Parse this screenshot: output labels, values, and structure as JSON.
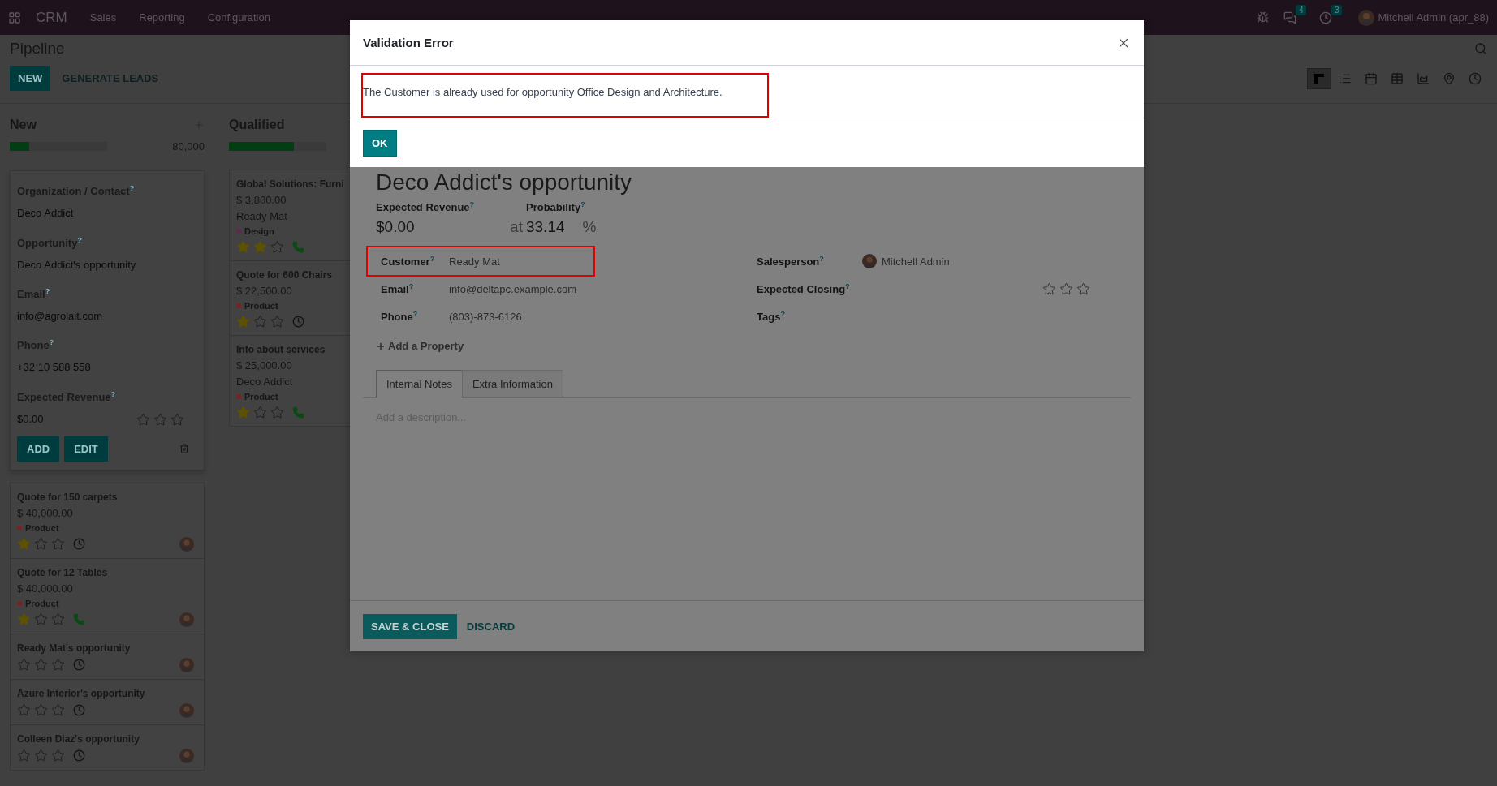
{
  "navbar": {
    "app": "CRM",
    "menus": [
      "Sales",
      "Reporting",
      "Configuration"
    ],
    "messages_badge": "4",
    "activities_badge": "3",
    "user": "Mitchell Admin (apr_88)"
  },
  "control_panel": {
    "breadcrumb": "Pipeline",
    "new_button": "NEW",
    "generate_button": "GENERATE LEADS",
    "views": [
      {
        "kind": "kanban",
        "selected": true
      },
      {
        "kind": "list",
        "selected": false
      },
      {
        "kind": "calendar",
        "selected": false
      },
      {
        "kind": "pivot",
        "selected": false
      },
      {
        "kind": "graph",
        "selected": false
      },
      {
        "kind": "map",
        "selected": false
      },
      {
        "kind": "activity",
        "selected": false
      }
    ]
  },
  "columns": [
    {
      "title": "New",
      "level": 0.2,
      "total": "80,000",
      "quick_create": {
        "fields": [
          {
            "label": "Organization / Contact$^{?}$",
            "value": "Deco Addict"
          },
          {
            "label": "Opportunity$^{?}$",
            "value": "Deco Addict's opportunity"
          },
          {
            "label": "Email$^{?}$",
            "value": "info@agrolait.com"
          },
          {
            "label": "Phone$^{?}$",
            "value": "+32 10 588 558"
          },
          {
            "label": "Expected Revenue$^{?}$",
            "value": "$0.00",
            "stars": 0
          }
        ],
        "buttons": [
          "ADD",
          "EDIT"
        ]
      },
      "cards": [
        {
          "title": "Quote for 150 carpets",
          "amount": "$ 40,000.00",
          "tag": {
            "label": "Product",
            "color": "#7a2222"
          },
          "stars": 1,
          "activity": {
            "kind": "clock"
          },
          "avatar": true
        },
        {
          "title": "Quote for 12 Tables",
          "amount": "$ 40,000.00",
          "tag": {
            "label": "Product",
            "color": "#7a2222"
          },
          "stars": 1,
          "activity": {
            "kind": "phone"
          },
          "avatar": true
        },
        {
          "title": "Ready Mat's opportunity",
          "stars": 0,
          "activity": {
            "kind": "clock"
          },
          "avatar": true
        },
        {
          "title": "Azure Interior's opportunity",
          "stars": 0,
          "activity": {
            "kind": "clock"
          },
          "avatar": true
        },
        {
          "title": "Colleen Diaz's opportunity",
          "stars": 0,
          "activity": {
            "kind": "clock"
          },
          "avatar": true
        }
      ]
    },
    {
      "title": "Qualified",
      "level": 0.67,
      "cards": [
        {
          "title": "Global Solutions: Furni",
          "amount": "$ 3,800.00",
          "customer": "Ready Mat",
          "tag": {
            "label": "Design",
            "color": "#5c2a4a"
          },
          "stars": 2,
          "activity": {
            "kind": "phone"
          },
          "avatar": false
        },
        {
          "title": "Quote for 600 Chairs",
          "amount": "$ 22,500.00",
          "tag": {
            "label": "Product",
            "color": "#7a2222"
          },
          "stars": 1,
          "activity": {
            "kind": "clock"
          },
          "avatar": false
        },
        {
          "title": "Info about services",
          "amount": "$ 25,000.00",
          "customer": "Deco Addict",
          "tag": {
            "label": "Product",
            "color": "#7a2222"
          },
          "stars": 1,
          "activity": {
            "kind": "phone"
          },
          "avatar": false
        }
      ]
    }
  ],
  "form": {
    "title": "Deco Addict's opportunity",
    "expected_revenue": {
      "label": "Expected Revenue$^{?}$",
      "value": "$0.00"
    },
    "at": "at",
    "probability": {
      "label": "Probability$^{?}$",
      "value": "33.14",
      "unit": "%"
    },
    "left_fields": [
      {
        "label": "Customer$^{?}$",
        "value": "Ready Mat",
        "highlighted": true
      },
      {
        "label": "Email$^{?}$",
        "value": "info@deltapc.example.com",
        "highlighted": false
      },
      {
        "label": "Phone$^{?}$",
        "value": "(803)-873-6126",
        "highlighted": false
      }
    ],
    "right_fields": [
      {
        "kind": "user",
        "label": "Salesperson$^{?}$",
        "value": "Mitchell Admin"
      },
      {
        "kind": "stars",
        "label": "Expected Closing$^{?}$",
        "stars": 0
      },
      {
        "kind": "text",
        "label": "Tags$^{?}$"
      }
    ],
    "add_property": "Add a Property",
    "tabs": [
      {
        "label": "Internal Notes",
        "selected": true
      },
      {
        "label": "Extra Information",
        "selected": false
      }
    ],
    "description_placeholder": "Add a description...",
    "footer_buttons": [
      {
        "kind": "primary",
        "label": "SAVE & CLOSE"
      },
      {
        "kind": "link",
        "label": "DISCARD"
      }
    ]
  },
  "dialog": {
    "title": "Validation Error",
    "message": "The Customer is already used for opportunity Office Design and Architecture.",
    "message_highlighted": true,
    "ok_button": "OK"
  }
}
